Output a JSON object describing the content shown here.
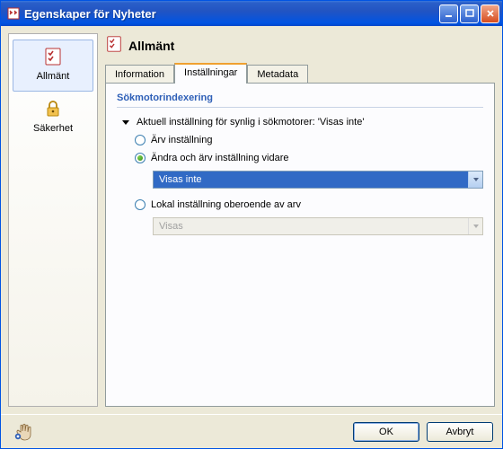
{
  "window": {
    "title": "Egenskaper för Nyheter"
  },
  "sidebar": {
    "items": [
      {
        "label": "Allmänt"
      },
      {
        "label": "Säkerhet"
      }
    ]
  },
  "main": {
    "title": "Allmänt"
  },
  "tabs": [
    {
      "label": "Information"
    },
    {
      "label": "Inställningar"
    },
    {
      "label": "Metadata"
    }
  ],
  "section": {
    "title": "Sökmotorindexering"
  },
  "current_setting": {
    "label": "Aktuell inställning för synlig i sökmotorer: 'Visas inte'"
  },
  "radios": {
    "inherit": "Ärv inställning",
    "change_inherit": "Ändra och ärv inställning vidare",
    "local": "Lokal inställning oberoende av arv"
  },
  "dropdowns": {
    "active_value": "Visas inte",
    "disabled_value": "Visas"
  },
  "footer": {
    "ok": "OK",
    "cancel": "Avbryt"
  }
}
